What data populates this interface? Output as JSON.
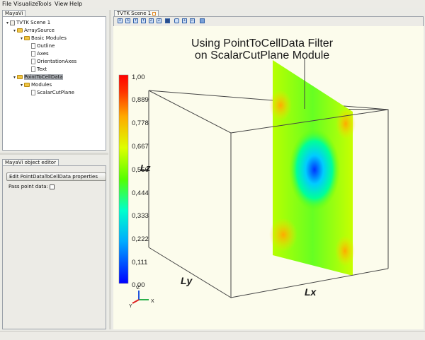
{
  "menubar": {
    "items": [
      "File",
      "Visualize",
      "Tools",
      "View",
      "Help"
    ]
  },
  "left_panel": {
    "tab_label": "MayaVi",
    "tree": [
      {
        "label": "TVTK Scene 1",
        "icon": "scene-icon",
        "toggle": "▾"
      },
      {
        "label": "ArraySource",
        "icon": "folder-icon",
        "toggle": "▾"
      },
      {
        "label": "Basic Modules",
        "icon": "folder-icon",
        "toggle": "▾"
      },
      {
        "label": "Outline",
        "icon": "document-icon",
        "toggle": ""
      },
      {
        "label": "Axes",
        "icon": "document-icon",
        "toggle": ""
      },
      {
        "label": "OrientationAxes",
        "icon": "document-icon",
        "toggle": ""
      },
      {
        "label": "Text",
        "icon": "document-icon",
        "toggle": ""
      },
      {
        "label": "PointToCellData",
        "icon": "folder-icon",
        "toggle": "▾",
        "selected": true
      },
      {
        "label": "Modules",
        "icon": "folder-icon",
        "toggle": "▾"
      },
      {
        "label": "ScalarCutPlane",
        "icon": "document-icon",
        "toggle": ""
      }
    ]
  },
  "editor_panel": {
    "tab_label": "MayaVi object editor",
    "edit_button": "Edit PointDataToCellData properties",
    "pass_point_data_label": "Pass point data:",
    "pass_point_data_checked": false
  },
  "scene": {
    "tab_label": "TVTK Scene 1",
    "toolbar_icons": [
      "view-x-icon",
      "view-neg-x-icon",
      "view-y-icon",
      "view-neg-y-icon",
      "view-z-icon",
      "view-neg-z-icon",
      "isometric-icon",
      "parallel-projection-icon",
      "axes-toggle-icon",
      "full-screen-icon",
      "save-icon"
    ],
    "title_line1": "Using PointToCellData Filter",
    "title_line2": "on ScalarCutPlane Module",
    "colorbar_ticks": [
      "1,00",
      "0,889",
      "0,778",
      "0,667",
      "0,556",
      "0,444",
      "0,333",
      "0,222",
      "0,111",
      "0,00"
    ],
    "axis_labels": {
      "x": "Lx",
      "y": "Ly",
      "z": "Lz"
    },
    "orientation_labels": {
      "x": "X",
      "y": "Y",
      "z": "Z"
    },
    "colors": {
      "background": "#fcfcec",
      "colormap": [
        "#0000ff",
        "#00aaff",
        "#00ffcc",
        "#55ff00",
        "#ddff00",
        "#ffaa00",
        "#ff3300",
        "#ff0000"
      ]
    }
  }
}
